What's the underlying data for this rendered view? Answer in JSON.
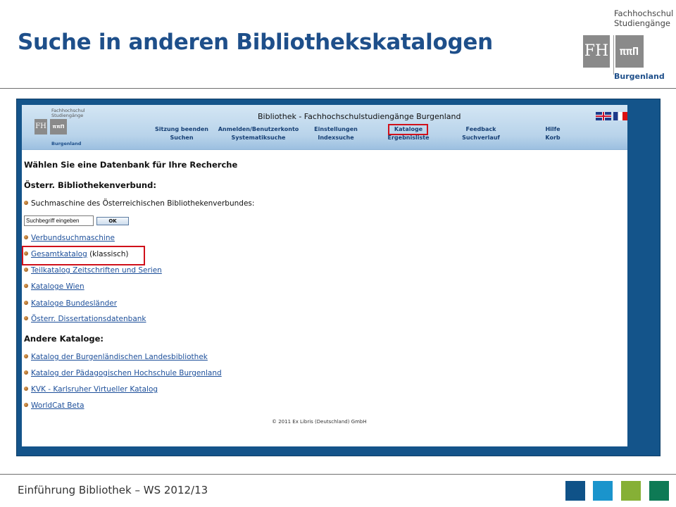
{
  "slide": {
    "title": "Suche in anderen Bibliothekskatalogen",
    "footer": "Einführung Bibliothek – WS 2012/13"
  },
  "logo": {
    "line1": "Fachhochschul",
    "line2": "Studiengänge",
    "fh": "FH",
    "region": "Burgenland"
  },
  "browser": {
    "mini_logo": {
      "line1": "Fachhochschul",
      "line2": "Studiengänge",
      "region": "Burgenland"
    },
    "title": "Bibliothek - Fachhochschulstudiengänge Burgenland",
    "nav_row1": [
      "Sitzung beenden",
      "Anmelden/Benutzerkonto",
      "Einstellungen",
      "Kataloge",
      "Feedback",
      "Hilfe"
    ],
    "nav_row2": [
      "Suchen",
      "Systematiksuche",
      "Indexsuche",
      "Ergebnisliste",
      "Suchverlauf",
      "Korb"
    ],
    "heading_main": "Wählen Sie eine Datenbank für Ihre Recherche",
    "section1": "Österr. Bibliothekenverbund:",
    "search_label": "Suchmaschine des Österreichischen Bibliothekenverbundes:",
    "search": {
      "value": "Suchbegriff eingeben",
      "button": "OK"
    },
    "obv_links": [
      {
        "label": "Verbundsuchmaschine",
        "suffix": ""
      },
      {
        "label": "Gesamtkatalog",
        "suffix": " (klassisch)"
      },
      {
        "label": "Teilkatalog Zeitschriften und Serien",
        "suffix": ""
      },
      {
        "label": "Kataloge Wien",
        "suffix": ""
      },
      {
        "label": "Kataloge Bundesländer",
        "suffix": ""
      },
      {
        "label": "Österr. Dissertationsdatenbank",
        "suffix": ""
      }
    ],
    "section2": "Andere Kataloge:",
    "other_links": [
      "Katalog der Burgenländischen Landesbibliothek",
      "Katalog der Pädagogischen Hochschule Burgenland",
      "KVK - Karlsruher Virtueller Katalog",
      "WorldCat Beta"
    ],
    "copyright": "© 2011 Ex Libris (Deutschland) GmbH"
  },
  "colors": {
    "title": "#1e4f8a",
    "frame": "#14548a",
    "highlight": "#d0101a",
    "footer_squares": [
      "#0f5288",
      "#1a94cc",
      "#86b036",
      "#0e7a55"
    ]
  }
}
